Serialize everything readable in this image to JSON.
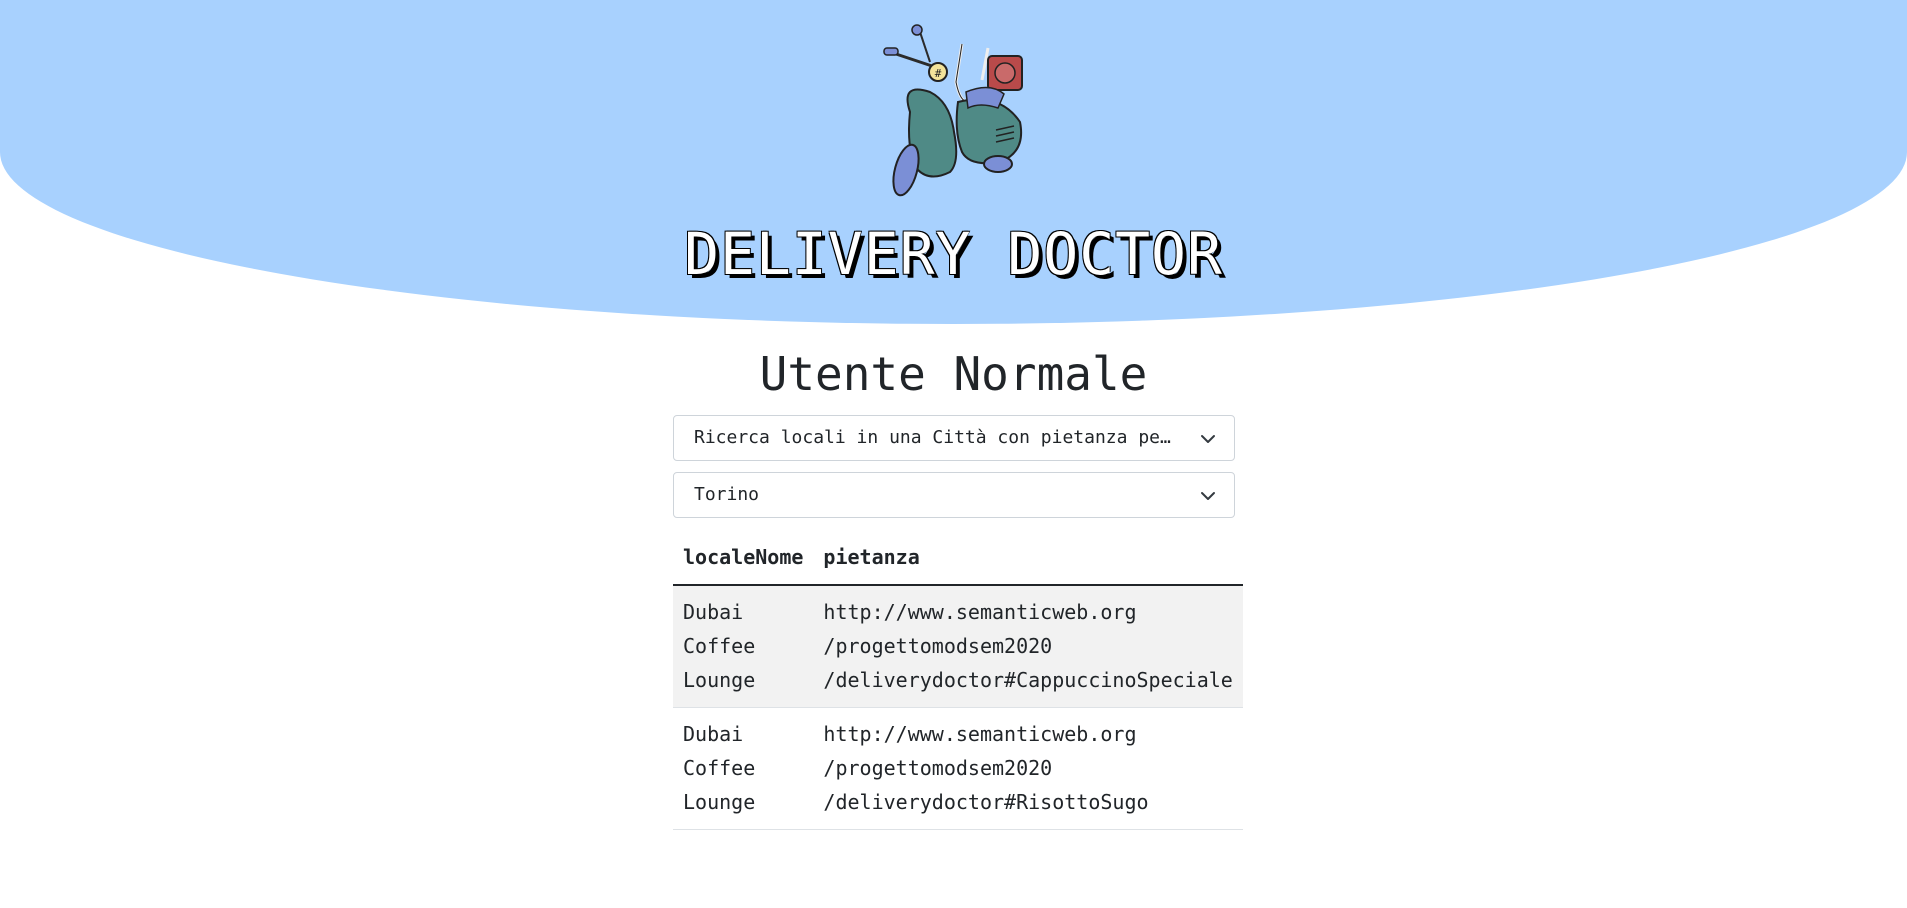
{
  "header": {
    "brand": "DELIVERY DOCTOR",
    "logo_icon": "scooter-logo-icon",
    "background_color": "#a8d1fe"
  },
  "main": {
    "title": "Utente Normale",
    "query_select": {
      "selected": "Ricerca locali in una Città con pietanza per celiaci",
      "icon": "chevron-down-icon"
    },
    "city_select": {
      "selected": "Torino",
      "icon": "chevron-down-icon"
    },
    "results_table": {
      "columns": [
        "localeNome",
        "pietanza"
      ],
      "rows": [
        {
          "locale": [
            "Dubai",
            "Coffee",
            "Lounge"
          ],
          "pietanza": [
            "http://www.semanticweb.org",
            "/progettomodsem2020",
            "/deliverydoctor#CappuccinoSpeciale"
          ]
        },
        {
          "locale": [
            "Dubai",
            "Coffee",
            "Lounge"
          ],
          "pietanza": [
            "http://www.semanticweb.org",
            "/progettomodsem2020",
            "/deliverydoctor#RisottoSugo"
          ]
        }
      ]
    }
  }
}
